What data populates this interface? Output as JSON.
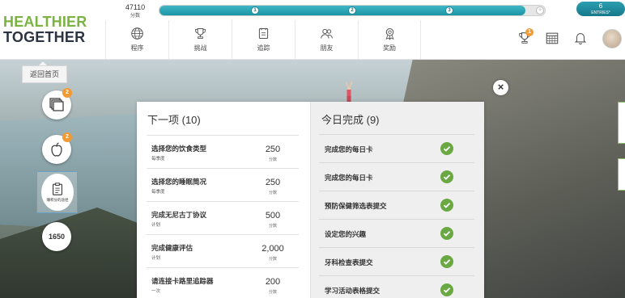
{
  "brand": {
    "line1": "HEALTHIER",
    "line2": "TOGETHER"
  },
  "points": {
    "value": "47110",
    "label": "分数"
  },
  "progress": {
    "fraction": 0.95,
    "milestones": [
      "1",
      "2",
      "3"
    ]
  },
  "entries": {
    "count": "6",
    "label": "ENTRIES*"
  },
  "nav": [
    {
      "label": "程序",
      "icon": "globe-icon"
    },
    {
      "label": "挑战",
      "icon": "trophy-icon"
    },
    {
      "label": "追踪",
      "icon": "tracker-icon"
    },
    {
      "label": "朋友",
      "icon": "friends-icon"
    },
    {
      "label": "奖励",
      "icon": "rewards-icon"
    }
  ],
  "header_icons": {
    "trophy_badge": "1"
  },
  "tooltip": "返回首页",
  "side": {
    "badge1": "2",
    "badge2": "2",
    "active_label": "赚积分的途径",
    "score": "1650"
  },
  "next_up": {
    "title": "下一项 (10)",
    "items": [
      {
        "name": "选择您的饮食类型",
        "sub": "每季度",
        "points": "250",
        "points_label": "分数"
      },
      {
        "name": "选择您的睡眠简况",
        "sub": "每季度",
        "points": "250",
        "points_label": "分数"
      },
      {
        "name": "完成无尼古丁协议",
        "sub": "计划",
        "points": "500",
        "points_label": "分数"
      },
      {
        "name": "完成健康评估",
        "sub": "计划",
        "points": "2,000",
        "points_label": "分数"
      },
      {
        "name": "请连接卡路里追踪器",
        "sub": "一次",
        "points": "200",
        "points_label": "分数"
      }
    ]
  },
  "completed_today": {
    "title": "今日完成 (9)",
    "items": [
      "完成您的每日卡",
      "完成您的每日卡",
      "预防保健筛选表提交",
      "设定您的兴趣",
      "牙科检查表提交",
      "学习活动表格提交"
    ]
  },
  "colors": {
    "accent": "#1d95a6",
    "brand_green": "#7ab33f",
    "check_green": "#6aa843",
    "badge": "#f39a32"
  }
}
